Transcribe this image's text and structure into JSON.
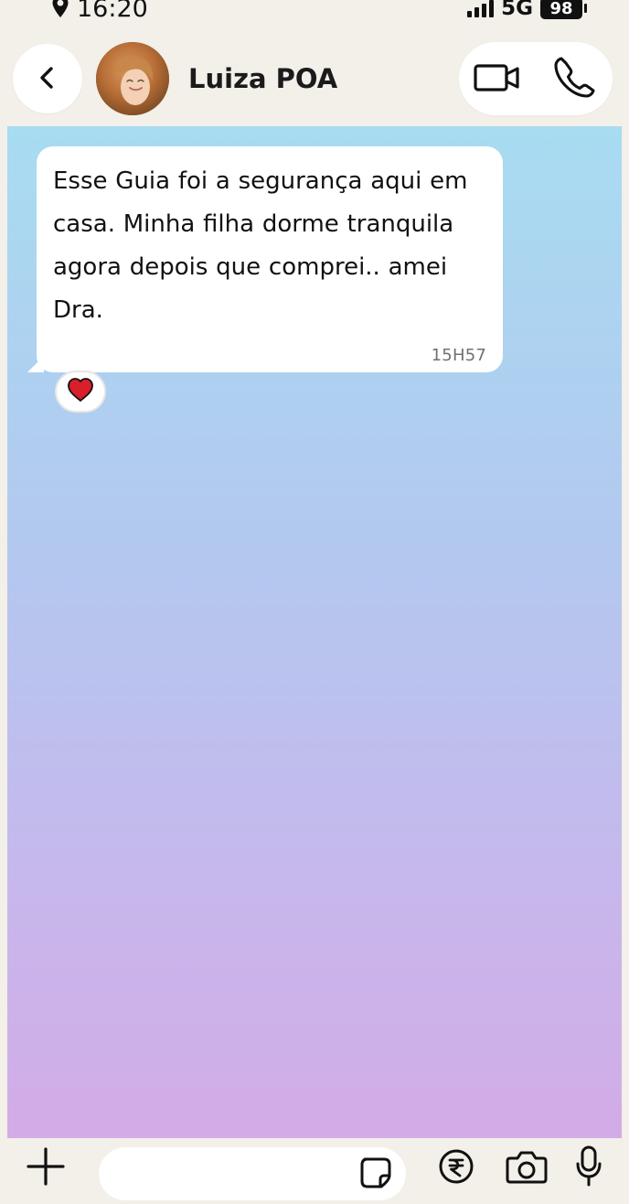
{
  "status_bar": {
    "time": "16:20",
    "network": "5G",
    "battery": "98"
  },
  "header": {
    "contact_name": "Luiza POA"
  },
  "message": {
    "text": "Esse Guia foi a segurança aqui em casa. Minha filha dorme tranquila agora depois que comprei.. amei Dra.",
    "time": "15H57",
    "reaction": "❤"
  },
  "input": {
    "value": "",
    "placeholder": ""
  },
  "icons": {
    "location": "location-icon",
    "back": "back-chevron-icon",
    "video": "video-call-icon",
    "phone": "phone-call-icon",
    "plus": "plus-icon",
    "sticker": "sticker-icon",
    "payment": "rupee-payment-icon",
    "camera": "camera-icon",
    "mic": "microphone-icon"
  },
  "colors": {
    "header_bg": "#f3efe9",
    "bubble_bg": "#ffffff",
    "gradient_top": "#a8dcf1",
    "gradient_mid": "#b3c8ef",
    "gradient_bottom": "#d3abe6",
    "heart": "#d81f2a"
  }
}
